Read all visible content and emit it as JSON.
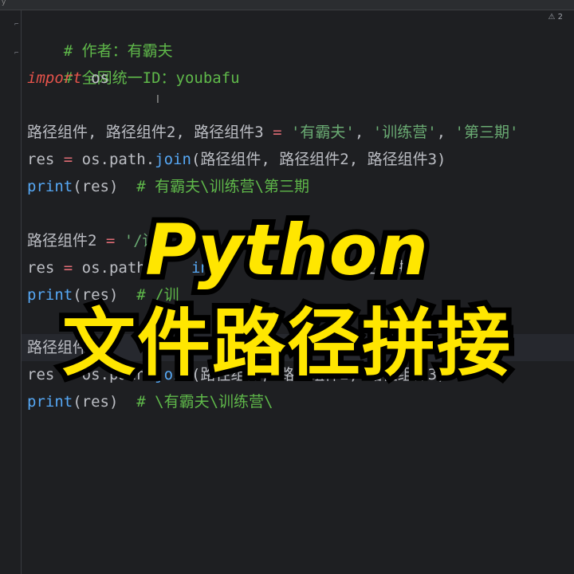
{
  "topbar": {
    "tab_label": "y"
  },
  "inspection": {
    "warning_icon": "warning-triangle-icon",
    "count": "2"
  },
  "code_lines": [
    {
      "text": "# 作者：有霸夫"
    },
    {
      "text": "# 全网统一ID：youbafu"
    },
    {
      "kw": "import",
      "rest": " os"
    },
    {
      "text": ""
    },
    {
      "vars": "路径组件, 路径组件2, 路径组件3",
      "eq": " = ",
      "s1": "'有霸夫'",
      "s2": "'训练营'",
      "s3": "'第三期'"
    },
    {
      "lhs": "res",
      "eq": " = ",
      "mod": "os.path.",
      "fn": "join",
      "args": "(路径组件, 路径组件2, 路径组件3)"
    },
    {
      "fn": "print",
      "args": "(res)",
      "comment": "  # 有霸夫\\训练营\\第三期"
    },
    {
      "text": ""
    },
    {
      "vars": "路径组件2",
      "eq": " = ",
      "s1": "'/训"
    },
    {
      "lhs": "res",
      "eq": " = ",
      "mod": "os.path",
      "fn": "in",
      "args": "路径组件3)"
    },
    {
      "fn": "print",
      "args": "(res)",
      "comment": "  # /训"
    },
    {
      "text": ""
    },
    {
      "vars": "路径组件",
      "tail": "'"
    },
    {
      "lhs": "res",
      "eq": " = ",
      "mod": "os.path.",
      "fn": "join",
      "args": "(路径组件, 路径组件2, 路径组件3)"
    },
    {
      "fn": "print",
      "args": "(res)",
      "comment": "  # \\有霸夫\\训练营\\"
    }
  ],
  "overlay": {
    "line1": "Python",
    "line2": "文件路径拼接"
  },
  "colors": {
    "overlay_text": "#ffe600",
    "overlay_stroke": "#000000",
    "background": "#1e1f22"
  }
}
